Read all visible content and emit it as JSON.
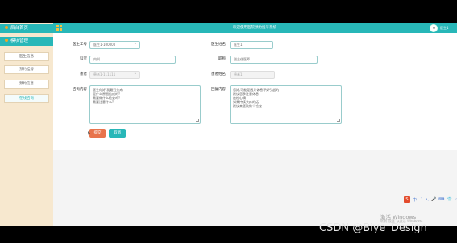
{
  "sidebar": {
    "home": "后台首页",
    "module": "模块管理",
    "items": [
      "医生信息",
      "预约挂号",
      "预约信息",
      "在线咨询"
    ]
  },
  "topbar": {
    "title": "欢迎使用医院预约挂号系统",
    "user": "医生1"
  },
  "form": {
    "doctor_id": {
      "label": "医生工号",
      "value": "医生1-100000"
    },
    "doctor_name": {
      "label": "医生姓名",
      "value": "医生1"
    },
    "department": {
      "label": "科室",
      "value": "内科"
    },
    "title": {
      "label": "职称",
      "value": "副主任医师"
    },
    "patient": {
      "label": "患者",
      "value": "患者1-111111"
    },
    "patient_name": {
      "label": "患者姓名",
      "value": "患者1"
    },
    "question": {
      "label": "咨询内容",
      "lines": [
        "医生你好,我最近头疼",
        "是什么原因造成的?",
        "需要做什么检查吗?",
        "需要注意什么?"
      ]
    },
    "reply": {
      "label": "回复内容",
      "lines": [
        "您好,可能是因为休息不好引起的",
        "建议您多注意休息",
        "放松心情",
        "如果持续头疼的话",
        "建议来医院做个检查"
      ]
    }
  },
  "buttons": {
    "submit": "提交",
    "cancel": "取消"
  },
  "tray": {
    "ime": "S",
    "lang": "中",
    "moon": "☽",
    "punct": "•,",
    "mic": "🎤",
    "keyboard": "⌨",
    "skin": "👕",
    "grid": "⁙"
  },
  "watermark": {
    "activate": "激活 Windows",
    "hint": "转到\"设置\"以激活 Windows。",
    "csdn": "CSDN @Biye_Design"
  },
  "colors": {
    "accent": "#28b7b8",
    "sidebar_bg": "#f7e8cf",
    "submit": "#e8744c"
  }
}
